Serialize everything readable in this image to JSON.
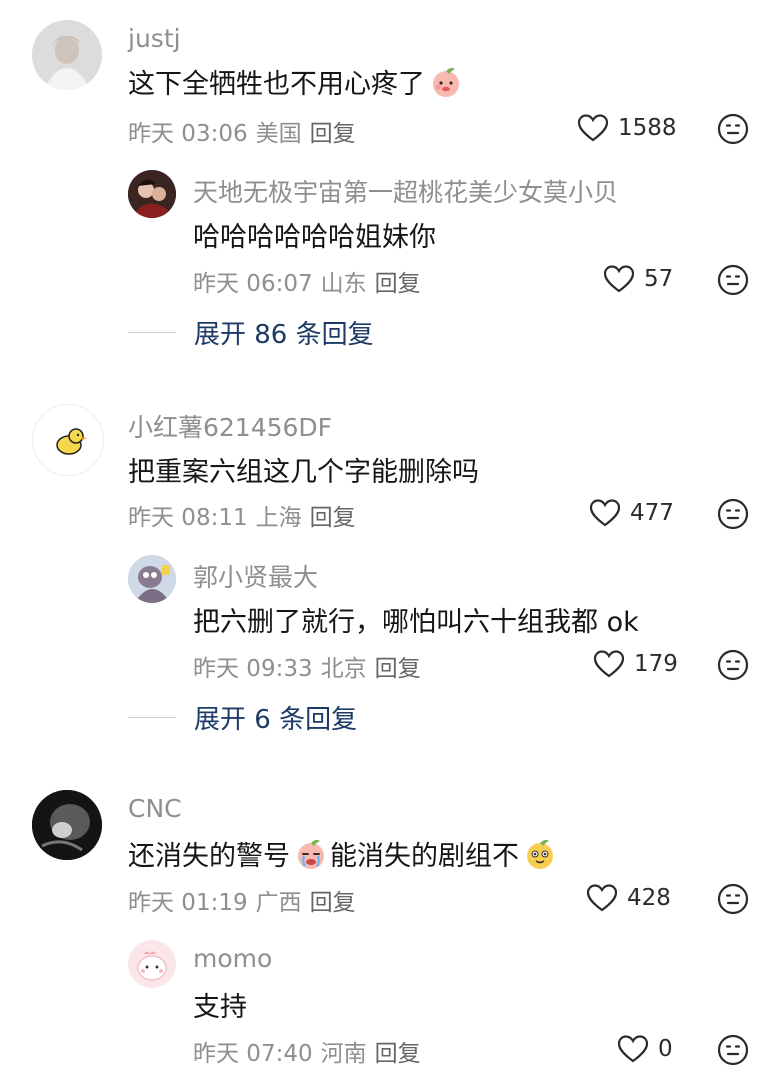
{
  "comments": [
    {
      "name": "justj",
      "text": "这下全牺牲也不用心疼了",
      "time": "昨天 03:06",
      "location": "美国",
      "reply_label": "回复",
      "likes": "1588",
      "replies": [
        {
          "name": "天地无极宇宙第一超桃花美少女莫小贝",
          "text": "哈哈哈哈哈哈姐妹你",
          "time": "昨天 06:07",
          "location": "山东",
          "reply_label": "回复",
          "likes": "57"
        }
      ],
      "expand_label": "展开 86 条回复"
    },
    {
      "name": "小红薯621456DF",
      "text": "把重案六组这几个字能删除吗",
      "time": "昨天 08:11",
      "location": "上海",
      "reply_label": "回复",
      "likes": "477",
      "replies": [
        {
          "name": "郭小贤最大",
          "text": "把六删了就行，哪怕叫六十组我都 ok",
          "time": "昨天 09:33",
          "location": "北京",
          "reply_label": "回复",
          "likes": "179"
        }
      ],
      "expand_label": "展开 6 条回复"
    },
    {
      "name": "CNC",
      "text_part1": "还消失的警号",
      "text_part2": "能消失的剧组不",
      "time": "昨天 01:19",
      "location": "广西",
      "reply_label": "回复",
      "likes": "428",
      "replies": [
        {
          "name": "momo",
          "text": "支持",
          "time": "昨天 07:40",
          "location": "河南",
          "reply_label": "回复",
          "likes": "0"
        }
      ]
    }
  ],
  "icons": {
    "like": "heart-outline-icon",
    "dislike": "neutral-face-icon"
  },
  "colors": {
    "name": "#8e8e93",
    "text": "#161616",
    "expand": "#1e3a66"
  }
}
